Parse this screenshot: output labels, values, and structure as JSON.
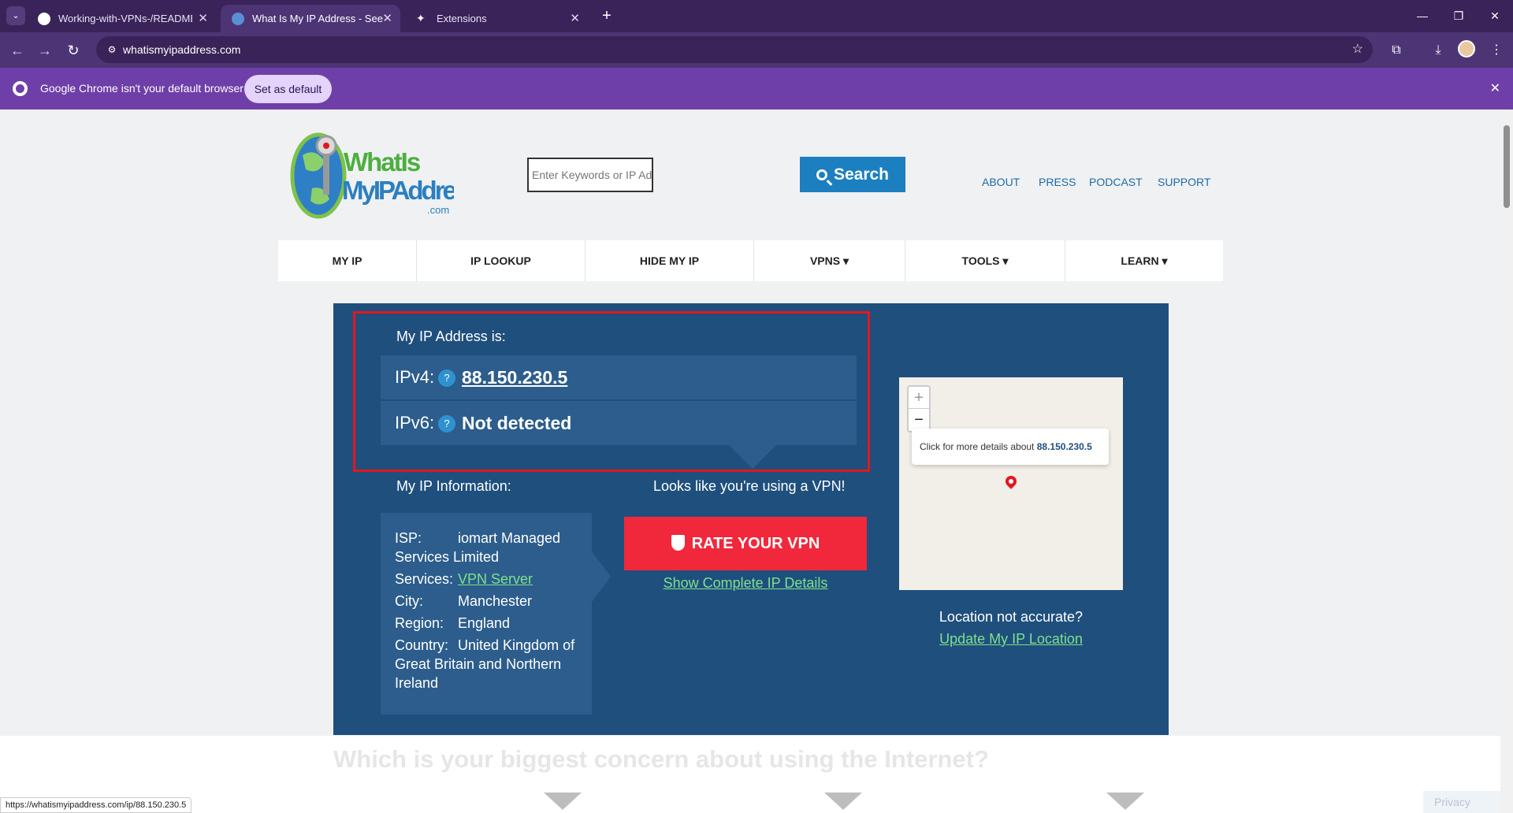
{
  "browser": {
    "tabs": [
      {
        "title": "Working-with-VPNs-/README.",
        "favicon": "github-icon"
      },
      {
        "title": "What Is My IP Address - See Yo",
        "favicon": "globe-icon"
      },
      {
        "title": "Extensions",
        "favicon": "puzzle-icon"
      }
    ],
    "url": "whatismyipaddress.com",
    "infobar": {
      "message": "Google Chrome isn't your default browser",
      "button": "Set as default"
    },
    "status_url": "https://whatismyipaddress.com/ip/88.150.230.5"
  },
  "site": {
    "logo": {
      "line1": "WhatIs",
      "line2": "MyIPAddress",
      "line3": ".com"
    },
    "search_placeholder": "Enter Keywords or IP Ad",
    "search_label": "Search",
    "top_links": [
      "ABOUT",
      "PRESS",
      "PODCAST",
      "SUPPORT"
    ],
    "nav": [
      "MY IP",
      "IP LOOKUP",
      "HIDE MY IP",
      "VPNS ▾",
      "TOOLS ▾",
      "LEARN ▾"
    ]
  },
  "ip": {
    "heading": "My IP Address is:",
    "ipv4_label": "IPv4:",
    "ipv4_value": "88.150.230.5",
    "ipv6_label": "IPv6:",
    "ipv6_value": "Not detected",
    "help_glyph": "?"
  },
  "info": {
    "heading": "My IP Information:",
    "isp_label": "ISP:",
    "isp_value": "iomart Managed Services Limited",
    "services_label": "Services:",
    "services_value": "VPN Server",
    "city_label": "City:",
    "city_value": "Manchester",
    "region_label": "Region:",
    "region_value": "England",
    "country_label": "Country:",
    "country_value": "United Kingdom of Great Britain and Northern Ireland"
  },
  "vpn": {
    "message": "Looks like you're using a VPN!",
    "rate_button": "RATE YOUR VPN",
    "details_link": "Show Complete IP Details"
  },
  "map": {
    "popup_prefix": "Click for more details about ",
    "popup_ip": "88.150.230.5",
    "zoom_in": "+",
    "zoom_out": "−",
    "location_question": "Location not accurate?",
    "update_link": "Update My IP Location"
  },
  "lower": {
    "heading": "Which is your biggest concern about using the Internet?",
    "privacy": "Privacy"
  }
}
